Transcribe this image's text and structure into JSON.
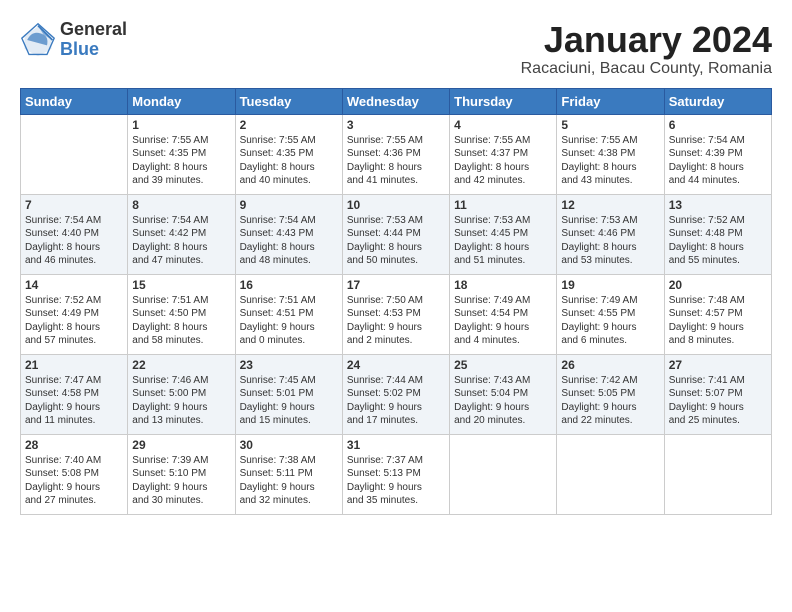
{
  "logo": {
    "general": "General",
    "blue": "Blue"
  },
  "title": {
    "month": "January 2024",
    "location": "Racaciuni, Bacau County, Romania"
  },
  "headers": [
    "Sunday",
    "Monday",
    "Tuesday",
    "Wednesday",
    "Thursday",
    "Friday",
    "Saturday"
  ],
  "weeks": [
    [
      {
        "day": "",
        "content": ""
      },
      {
        "day": "1",
        "content": "Sunrise: 7:55 AM\nSunset: 4:35 PM\nDaylight: 8 hours\nand 39 minutes."
      },
      {
        "day": "2",
        "content": "Sunrise: 7:55 AM\nSunset: 4:35 PM\nDaylight: 8 hours\nand 40 minutes."
      },
      {
        "day": "3",
        "content": "Sunrise: 7:55 AM\nSunset: 4:36 PM\nDaylight: 8 hours\nand 41 minutes."
      },
      {
        "day": "4",
        "content": "Sunrise: 7:55 AM\nSunset: 4:37 PM\nDaylight: 8 hours\nand 42 minutes."
      },
      {
        "day": "5",
        "content": "Sunrise: 7:55 AM\nSunset: 4:38 PM\nDaylight: 8 hours\nand 43 minutes."
      },
      {
        "day": "6",
        "content": "Sunrise: 7:54 AM\nSunset: 4:39 PM\nDaylight: 8 hours\nand 44 minutes."
      }
    ],
    [
      {
        "day": "7",
        "content": "Sunrise: 7:54 AM\nSunset: 4:40 PM\nDaylight: 8 hours\nand 46 minutes."
      },
      {
        "day": "8",
        "content": "Sunrise: 7:54 AM\nSunset: 4:42 PM\nDaylight: 8 hours\nand 47 minutes."
      },
      {
        "day": "9",
        "content": "Sunrise: 7:54 AM\nSunset: 4:43 PM\nDaylight: 8 hours\nand 48 minutes."
      },
      {
        "day": "10",
        "content": "Sunrise: 7:53 AM\nSunset: 4:44 PM\nDaylight: 8 hours\nand 50 minutes."
      },
      {
        "day": "11",
        "content": "Sunrise: 7:53 AM\nSunset: 4:45 PM\nDaylight: 8 hours\nand 51 minutes."
      },
      {
        "day": "12",
        "content": "Sunrise: 7:53 AM\nSunset: 4:46 PM\nDaylight: 8 hours\nand 53 minutes."
      },
      {
        "day": "13",
        "content": "Sunrise: 7:52 AM\nSunset: 4:48 PM\nDaylight: 8 hours\nand 55 minutes."
      }
    ],
    [
      {
        "day": "14",
        "content": "Sunrise: 7:52 AM\nSunset: 4:49 PM\nDaylight: 8 hours\nand 57 minutes."
      },
      {
        "day": "15",
        "content": "Sunrise: 7:51 AM\nSunset: 4:50 PM\nDaylight: 8 hours\nand 58 minutes."
      },
      {
        "day": "16",
        "content": "Sunrise: 7:51 AM\nSunset: 4:51 PM\nDaylight: 9 hours\nand 0 minutes."
      },
      {
        "day": "17",
        "content": "Sunrise: 7:50 AM\nSunset: 4:53 PM\nDaylight: 9 hours\nand 2 minutes."
      },
      {
        "day": "18",
        "content": "Sunrise: 7:49 AM\nSunset: 4:54 PM\nDaylight: 9 hours\nand 4 minutes."
      },
      {
        "day": "19",
        "content": "Sunrise: 7:49 AM\nSunset: 4:55 PM\nDaylight: 9 hours\nand 6 minutes."
      },
      {
        "day": "20",
        "content": "Sunrise: 7:48 AM\nSunset: 4:57 PM\nDaylight: 9 hours\nand 8 minutes."
      }
    ],
    [
      {
        "day": "21",
        "content": "Sunrise: 7:47 AM\nSunset: 4:58 PM\nDaylight: 9 hours\nand 11 minutes."
      },
      {
        "day": "22",
        "content": "Sunrise: 7:46 AM\nSunset: 5:00 PM\nDaylight: 9 hours\nand 13 minutes."
      },
      {
        "day": "23",
        "content": "Sunrise: 7:45 AM\nSunset: 5:01 PM\nDaylight: 9 hours\nand 15 minutes."
      },
      {
        "day": "24",
        "content": "Sunrise: 7:44 AM\nSunset: 5:02 PM\nDaylight: 9 hours\nand 17 minutes."
      },
      {
        "day": "25",
        "content": "Sunrise: 7:43 AM\nSunset: 5:04 PM\nDaylight: 9 hours\nand 20 minutes."
      },
      {
        "day": "26",
        "content": "Sunrise: 7:42 AM\nSunset: 5:05 PM\nDaylight: 9 hours\nand 22 minutes."
      },
      {
        "day": "27",
        "content": "Sunrise: 7:41 AM\nSunset: 5:07 PM\nDaylight: 9 hours\nand 25 minutes."
      }
    ],
    [
      {
        "day": "28",
        "content": "Sunrise: 7:40 AM\nSunset: 5:08 PM\nDaylight: 9 hours\nand 27 minutes."
      },
      {
        "day": "29",
        "content": "Sunrise: 7:39 AM\nSunset: 5:10 PM\nDaylight: 9 hours\nand 30 minutes."
      },
      {
        "day": "30",
        "content": "Sunrise: 7:38 AM\nSunset: 5:11 PM\nDaylight: 9 hours\nand 32 minutes."
      },
      {
        "day": "31",
        "content": "Sunrise: 7:37 AM\nSunset: 5:13 PM\nDaylight: 9 hours\nand 35 minutes."
      },
      {
        "day": "",
        "content": ""
      },
      {
        "day": "",
        "content": ""
      },
      {
        "day": "",
        "content": ""
      }
    ]
  ]
}
